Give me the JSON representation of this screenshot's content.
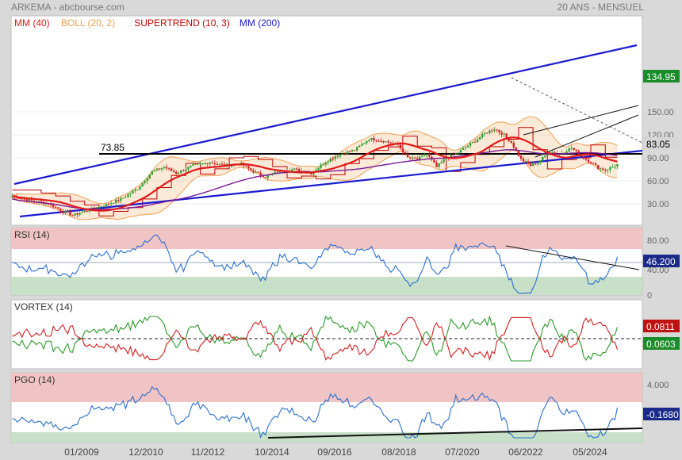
{
  "header": {
    "left": "ARKEMA - abcbourse.com",
    "right": "20 ANS - MENSUEL"
  },
  "legend": [
    {
      "label": "MM (40)",
      "color": "#e41a1a"
    },
    {
      "label": "BOLL (20, 2)",
      "color": "#f0a050"
    },
    {
      "label": "SUPERTREND (10, 3)",
      "color": "#c00000"
    },
    {
      "label": "MM (200)",
      "color": "#1a1ad0"
    }
  ],
  "colors": {
    "up": "#2ea02e",
    "down": "#d42020",
    "channel": "#1a1ad0",
    "mm40": "#e41a1a",
    "boll": "#f0a050",
    "supertrend": "#c00000",
    "mm200": "#7a1a9a",
    "rsi": "#2a6fd0",
    "vortex_pos": "#2a9a2a",
    "vortex_neg": "#d42020",
    "pgo": "#2a6fd0",
    "last_price_bg": "#1a8c2a"
  },
  "price_panel": {
    "yticks": [
      "150.00",
      "120.00",
      "90.00",
      "60.00",
      "30.00"
    ],
    "ylim": [
      10,
      170
    ],
    "support_label": "73.85",
    "last_price": "134.95",
    "current_price": "83.05"
  },
  "rsi_panel": {
    "title": "RSI (14)",
    "yticks": [
      "80.00",
      "40.00",
      "0"
    ],
    "last_value": "46.200"
  },
  "vortex_panel": {
    "title": "VORTEX (14)",
    "last_neg": "0.0811",
    "last_pos": "0.0603"
  },
  "pgo_panel": {
    "title": "PGO (14)",
    "yticks": [
      "4.000"
    ],
    "last_value": "-0.1680"
  },
  "xaxis": {
    "ticks": [
      "01/2009",
      "12/2010",
      "11/2012",
      "10/2014",
      "09/2016",
      "08/2018",
      "07/2020",
      "06/2022",
      "05/2024"
    ]
  },
  "chart_data": {
    "type": "candlestick",
    "period": "monthly",
    "x": [
      "2006-05",
      "2008-01",
      "2009-01",
      "2010-12",
      "2012-11",
      "2014-10",
      "2016-09",
      "2018-08",
      "2020-07",
      "2021-12",
      "2022-06",
      "2023-06",
      "2024-05",
      "2024-11"
    ],
    "close_estimate": [
      38,
      28,
      18,
      62,
      82,
      70,
      80,
      110,
      92,
      130,
      95,
      98,
      96,
      83.05
    ],
    "support_level": 73.85,
    "rsi_estimate": [
      70,
      40,
      20,
      75,
      65,
      45,
      60,
      70,
      45,
      70,
      40,
      48,
      42,
      46.2
    ],
    "pgo_estimate": [
      2,
      1,
      -1,
      4,
      2,
      -1,
      3,
      2,
      -0.5,
      2.5,
      -0.5,
      1,
      0.5,
      -0.168
    ]
  }
}
